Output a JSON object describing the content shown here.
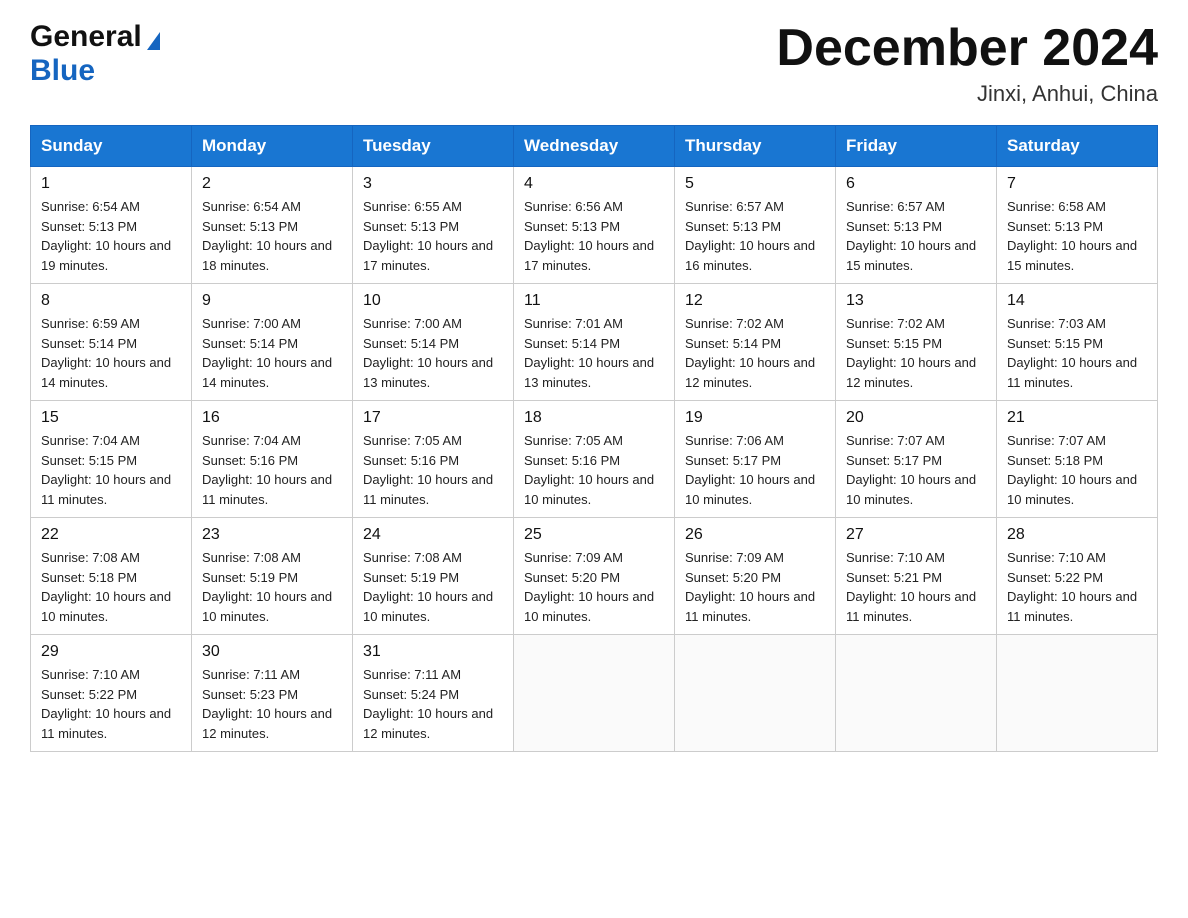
{
  "logo": {
    "general": "General",
    "blue": "Blue",
    "triangle": "▶"
  },
  "header": {
    "title": "December 2024",
    "subtitle": "Jinxi, Anhui, China"
  },
  "weekdays": [
    "Sunday",
    "Monday",
    "Tuesday",
    "Wednesday",
    "Thursday",
    "Friday",
    "Saturday"
  ],
  "weeks": [
    [
      {
        "day": "1",
        "sunrise": "6:54 AM",
        "sunset": "5:13 PM",
        "daylight": "10 hours and 19 minutes."
      },
      {
        "day": "2",
        "sunrise": "6:54 AM",
        "sunset": "5:13 PM",
        "daylight": "10 hours and 18 minutes."
      },
      {
        "day": "3",
        "sunrise": "6:55 AM",
        "sunset": "5:13 PM",
        "daylight": "10 hours and 17 minutes."
      },
      {
        "day": "4",
        "sunrise": "6:56 AM",
        "sunset": "5:13 PM",
        "daylight": "10 hours and 17 minutes."
      },
      {
        "day": "5",
        "sunrise": "6:57 AM",
        "sunset": "5:13 PM",
        "daylight": "10 hours and 16 minutes."
      },
      {
        "day": "6",
        "sunrise": "6:57 AM",
        "sunset": "5:13 PM",
        "daylight": "10 hours and 15 minutes."
      },
      {
        "day": "7",
        "sunrise": "6:58 AM",
        "sunset": "5:13 PM",
        "daylight": "10 hours and 15 minutes."
      }
    ],
    [
      {
        "day": "8",
        "sunrise": "6:59 AM",
        "sunset": "5:14 PM",
        "daylight": "10 hours and 14 minutes."
      },
      {
        "day": "9",
        "sunrise": "7:00 AM",
        "sunset": "5:14 PM",
        "daylight": "10 hours and 14 minutes."
      },
      {
        "day": "10",
        "sunrise": "7:00 AM",
        "sunset": "5:14 PM",
        "daylight": "10 hours and 13 minutes."
      },
      {
        "day": "11",
        "sunrise": "7:01 AM",
        "sunset": "5:14 PM",
        "daylight": "10 hours and 13 minutes."
      },
      {
        "day": "12",
        "sunrise": "7:02 AM",
        "sunset": "5:14 PM",
        "daylight": "10 hours and 12 minutes."
      },
      {
        "day": "13",
        "sunrise": "7:02 AM",
        "sunset": "5:15 PM",
        "daylight": "10 hours and 12 minutes."
      },
      {
        "day": "14",
        "sunrise": "7:03 AM",
        "sunset": "5:15 PM",
        "daylight": "10 hours and 11 minutes."
      }
    ],
    [
      {
        "day": "15",
        "sunrise": "7:04 AM",
        "sunset": "5:15 PM",
        "daylight": "10 hours and 11 minutes."
      },
      {
        "day": "16",
        "sunrise": "7:04 AM",
        "sunset": "5:16 PM",
        "daylight": "10 hours and 11 minutes."
      },
      {
        "day": "17",
        "sunrise": "7:05 AM",
        "sunset": "5:16 PM",
        "daylight": "10 hours and 11 minutes."
      },
      {
        "day": "18",
        "sunrise": "7:05 AM",
        "sunset": "5:16 PM",
        "daylight": "10 hours and 10 minutes."
      },
      {
        "day": "19",
        "sunrise": "7:06 AM",
        "sunset": "5:17 PM",
        "daylight": "10 hours and 10 minutes."
      },
      {
        "day": "20",
        "sunrise": "7:07 AM",
        "sunset": "5:17 PM",
        "daylight": "10 hours and 10 minutes."
      },
      {
        "day": "21",
        "sunrise": "7:07 AM",
        "sunset": "5:18 PM",
        "daylight": "10 hours and 10 minutes."
      }
    ],
    [
      {
        "day": "22",
        "sunrise": "7:08 AM",
        "sunset": "5:18 PM",
        "daylight": "10 hours and 10 minutes."
      },
      {
        "day": "23",
        "sunrise": "7:08 AM",
        "sunset": "5:19 PM",
        "daylight": "10 hours and 10 minutes."
      },
      {
        "day": "24",
        "sunrise": "7:08 AM",
        "sunset": "5:19 PM",
        "daylight": "10 hours and 10 minutes."
      },
      {
        "day": "25",
        "sunrise": "7:09 AM",
        "sunset": "5:20 PM",
        "daylight": "10 hours and 10 minutes."
      },
      {
        "day": "26",
        "sunrise": "7:09 AM",
        "sunset": "5:20 PM",
        "daylight": "10 hours and 11 minutes."
      },
      {
        "day": "27",
        "sunrise": "7:10 AM",
        "sunset": "5:21 PM",
        "daylight": "10 hours and 11 minutes."
      },
      {
        "day": "28",
        "sunrise": "7:10 AM",
        "sunset": "5:22 PM",
        "daylight": "10 hours and 11 minutes."
      }
    ],
    [
      {
        "day": "29",
        "sunrise": "7:10 AM",
        "sunset": "5:22 PM",
        "daylight": "10 hours and 11 minutes."
      },
      {
        "day": "30",
        "sunrise": "7:11 AM",
        "sunset": "5:23 PM",
        "daylight": "10 hours and 12 minutes."
      },
      {
        "day": "31",
        "sunrise": "7:11 AM",
        "sunset": "5:24 PM",
        "daylight": "10 hours and 12 minutes."
      },
      null,
      null,
      null,
      null
    ]
  ]
}
